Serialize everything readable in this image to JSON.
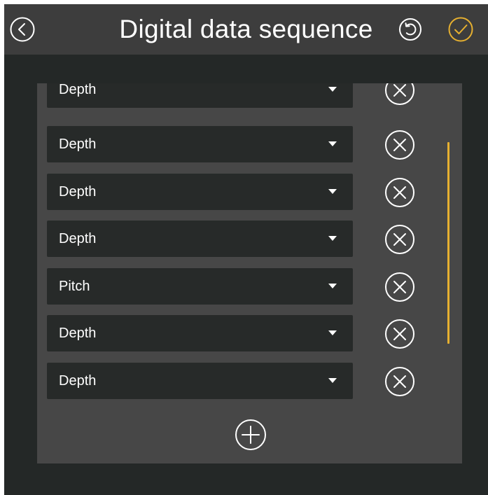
{
  "header": {
    "title": "Digital data sequence",
    "back_icon": "chevron-left-circle-icon",
    "reset_icon": "reset-icon",
    "confirm_icon": "check-circle-icon"
  },
  "sequence": {
    "items": [
      {
        "value": "Depth"
      },
      {
        "value": "Depth"
      },
      {
        "value": "Depth"
      },
      {
        "value": "Depth"
      },
      {
        "value": "Pitch"
      },
      {
        "value": "Depth"
      },
      {
        "value": "Depth"
      }
    ],
    "remove_icon": "close-circle-icon",
    "add_icon": "plus-circle-icon"
  },
  "colors": {
    "background": "#242827",
    "header": "#3d3d3d",
    "panel": "#474747",
    "select": "#272a29",
    "accent": "#e6b030",
    "text": "#ffffff"
  }
}
